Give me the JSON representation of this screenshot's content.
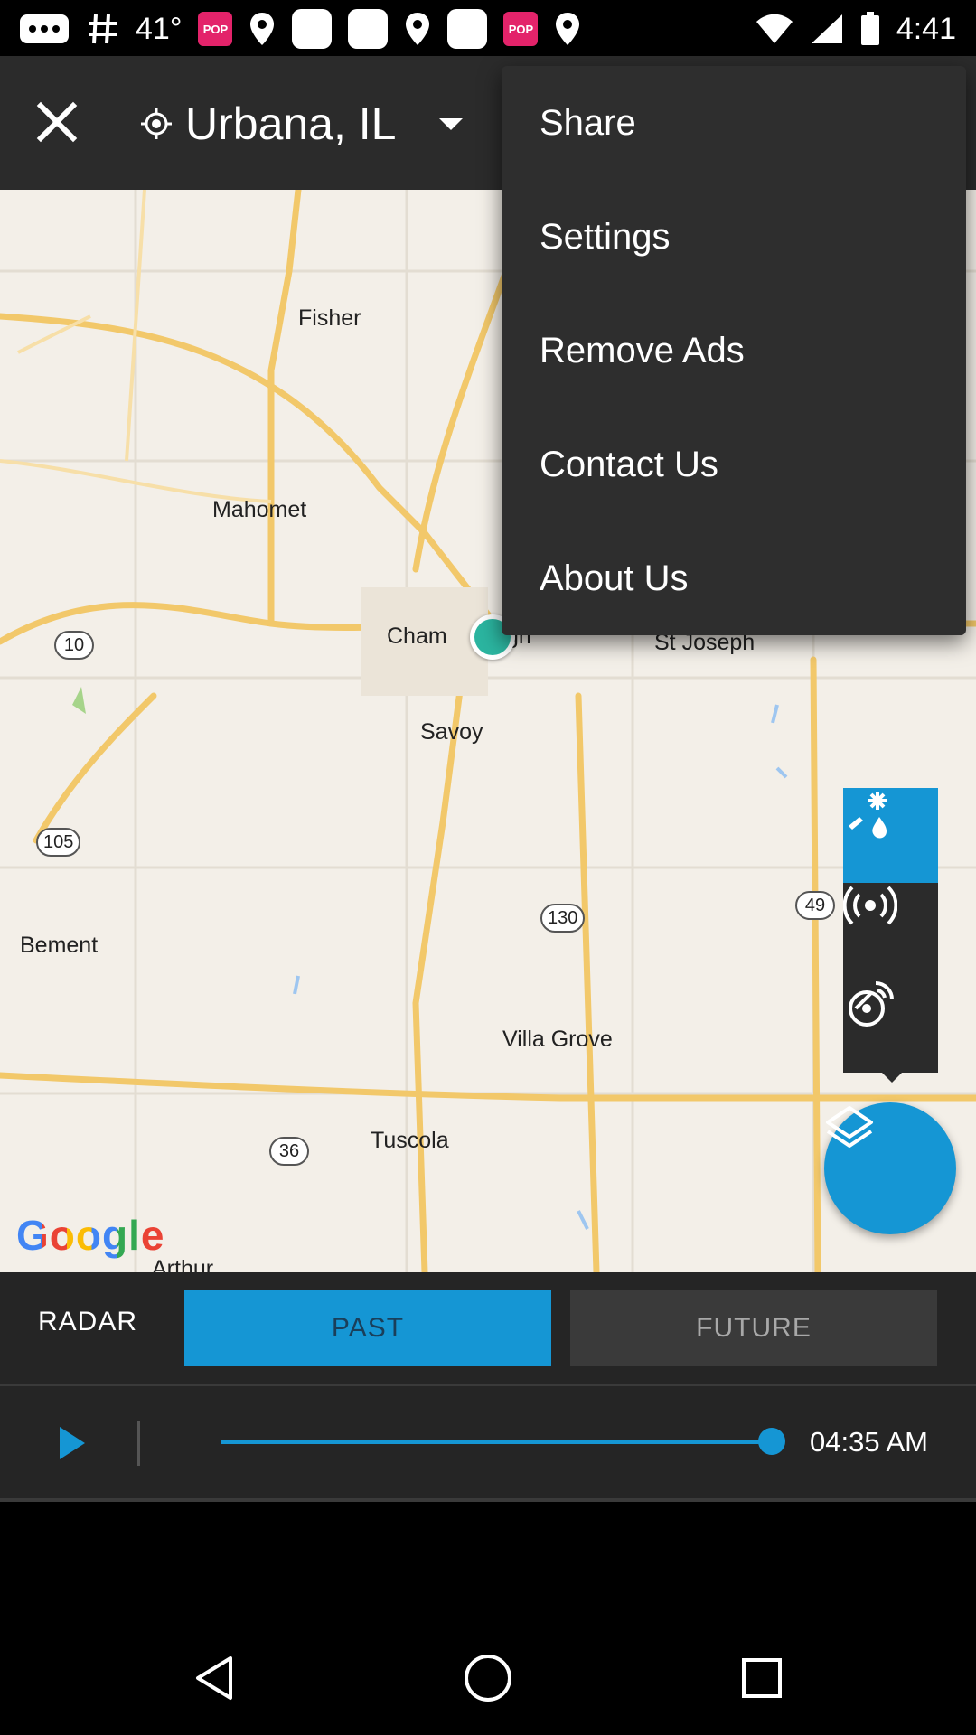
{
  "status_bar": {
    "temperature": "41°",
    "time": "4:41",
    "pop_label": "POP"
  },
  "topbar": {
    "location": "Urbana, IL"
  },
  "menu": {
    "items": [
      "Share",
      "Settings",
      "Remove Ads",
      "Contact Us",
      "About Us"
    ]
  },
  "map": {
    "labels": {
      "fisher": "Fisher",
      "mahomet": "Mahomet",
      "champaign_left": "Cham",
      "champaign_right": "gn",
      "st_joseph": "St Joseph",
      "savoy": "Savoy",
      "bement": "Bement",
      "villa_grove": "Villa Grove",
      "tuscola": "Tuscola",
      "arthur": "Arthur"
    },
    "shields": {
      "r10": "10",
      "r105": "105",
      "r130": "130",
      "r49": "49",
      "r36": "36"
    },
    "attribution": "Google"
  },
  "controls": {
    "radar_label": "RADAR",
    "past_label": "PAST",
    "future_label": "FUTURE",
    "time": "04:35 AM",
    "progress": 1.0
  },
  "colors": {
    "accent": "#1596d4",
    "panel": "#252525",
    "menu": "#2e2e2e",
    "location_dot": "#2bb5a0"
  }
}
